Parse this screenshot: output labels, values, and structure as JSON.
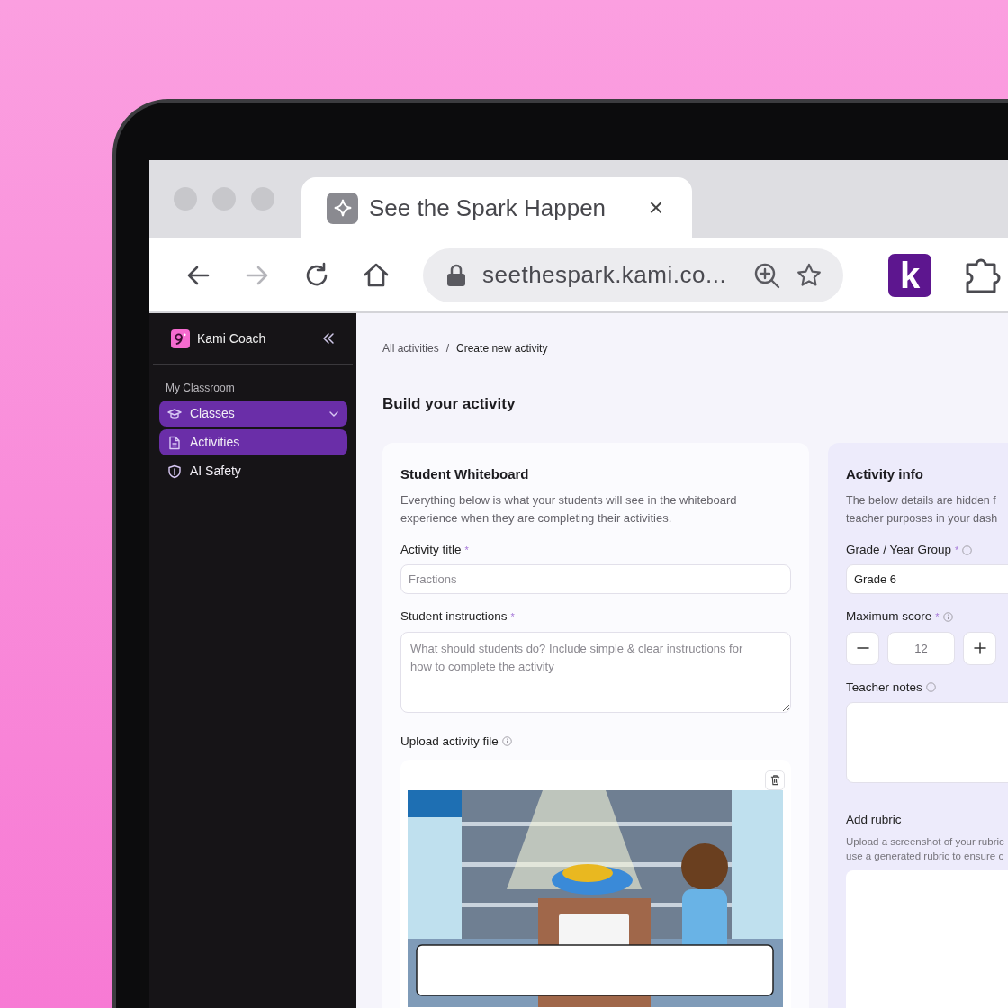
{
  "browser": {
    "tab": {
      "title": "See the Spark Happen",
      "close": "×"
    },
    "address": "seethespark.kami.co...",
    "extension_letter": "k"
  },
  "sidebar": {
    "app_name": "Kami Coach",
    "section": "My Classroom",
    "items": [
      {
        "label": "Classes",
        "kind": "dropdown",
        "selected": true
      },
      {
        "label": "Activities",
        "kind": "document",
        "selected": true
      },
      {
        "label": "AI Safety",
        "kind": "shield",
        "selected": false
      }
    ]
  },
  "breadcrumb": {
    "items": [
      "All activities",
      "Create new activity"
    ],
    "separator": "/"
  },
  "page_title": "Build your activity",
  "whiteboard": {
    "title": "Student Whiteboard",
    "description": "Everything below is what your students will see in the whiteboard experience when they are completing their activities.",
    "fields": [
      {
        "kind": "input",
        "label": "Activity title",
        "required_mark": "*",
        "placeholder": "Fractions"
      },
      {
        "kind": "textarea",
        "label": "Student instructions",
        "required_mark": "*",
        "placeholder": "What should students do? Include simple & clear instructions for how to complete the activity"
      },
      {
        "kind": "upload",
        "label": "Upload activity file",
        "info": true
      }
    ]
  },
  "activity_info": {
    "title": "Activity info",
    "description_lines": [
      "The below details are hidden f",
      "teacher purposes in your dash"
    ],
    "fields": [
      {
        "kind": "select",
        "label": "Grade / Year Group",
        "required_mark": "*",
        "info": true,
        "value": "Grade 6"
      },
      {
        "kind": "stepper",
        "label": "Maximum score",
        "required_mark": "*",
        "info": true,
        "value": "12"
      },
      {
        "kind": "textarea",
        "label": "Teacher notes",
        "info": true
      },
      {
        "kind": "rubric",
        "label": "Add rubric",
        "description_lines": [
          "Upload a screenshot of your rubric",
          "use a generated rubric to ensure c"
        ]
      }
    ]
  }
}
